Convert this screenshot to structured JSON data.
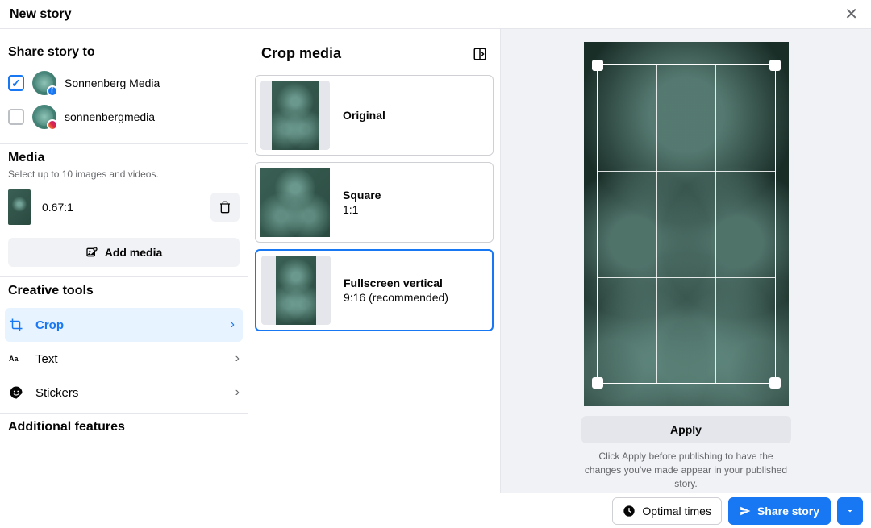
{
  "header": {
    "title": "New story",
    "close": "✕"
  },
  "share": {
    "title": "Share story to",
    "accounts": [
      {
        "name": "Sonnenberg Media",
        "platform": "facebook",
        "checked": true
      },
      {
        "name": "sonnenbergmedia",
        "platform": "instagram",
        "checked": false
      }
    ]
  },
  "media": {
    "title": "Media",
    "subtitle": "Select up to 10 images and videos.",
    "items": [
      {
        "ratio": "0.67:1"
      }
    ],
    "add_label": "Add media"
  },
  "tools": {
    "title": "Creative tools",
    "crop": "Crop",
    "text": "Text",
    "stickers": "Stickers"
  },
  "additional": {
    "title": "Additional features"
  },
  "crop": {
    "title": "Crop media",
    "options": [
      {
        "label": "Original",
        "sub": "",
        "shape": "original",
        "selected": false
      },
      {
        "label": "Square",
        "sub": "1:1",
        "shape": "square",
        "selected": false
      },
      {
        "label": "Fullscreen vertical",
        "sub": "9:16 (recommended)",
        "shape": "vertical",
        "selected": true
      }
    ]
  },
  "preview": {
    "apply": "Apply",
    "hint": "Click Apply before publishing to have the changes you've made appear in your published story."
  },
  "footer": {
    "optimal": "Optimal times",
    "share": "Share story"
  }
}
